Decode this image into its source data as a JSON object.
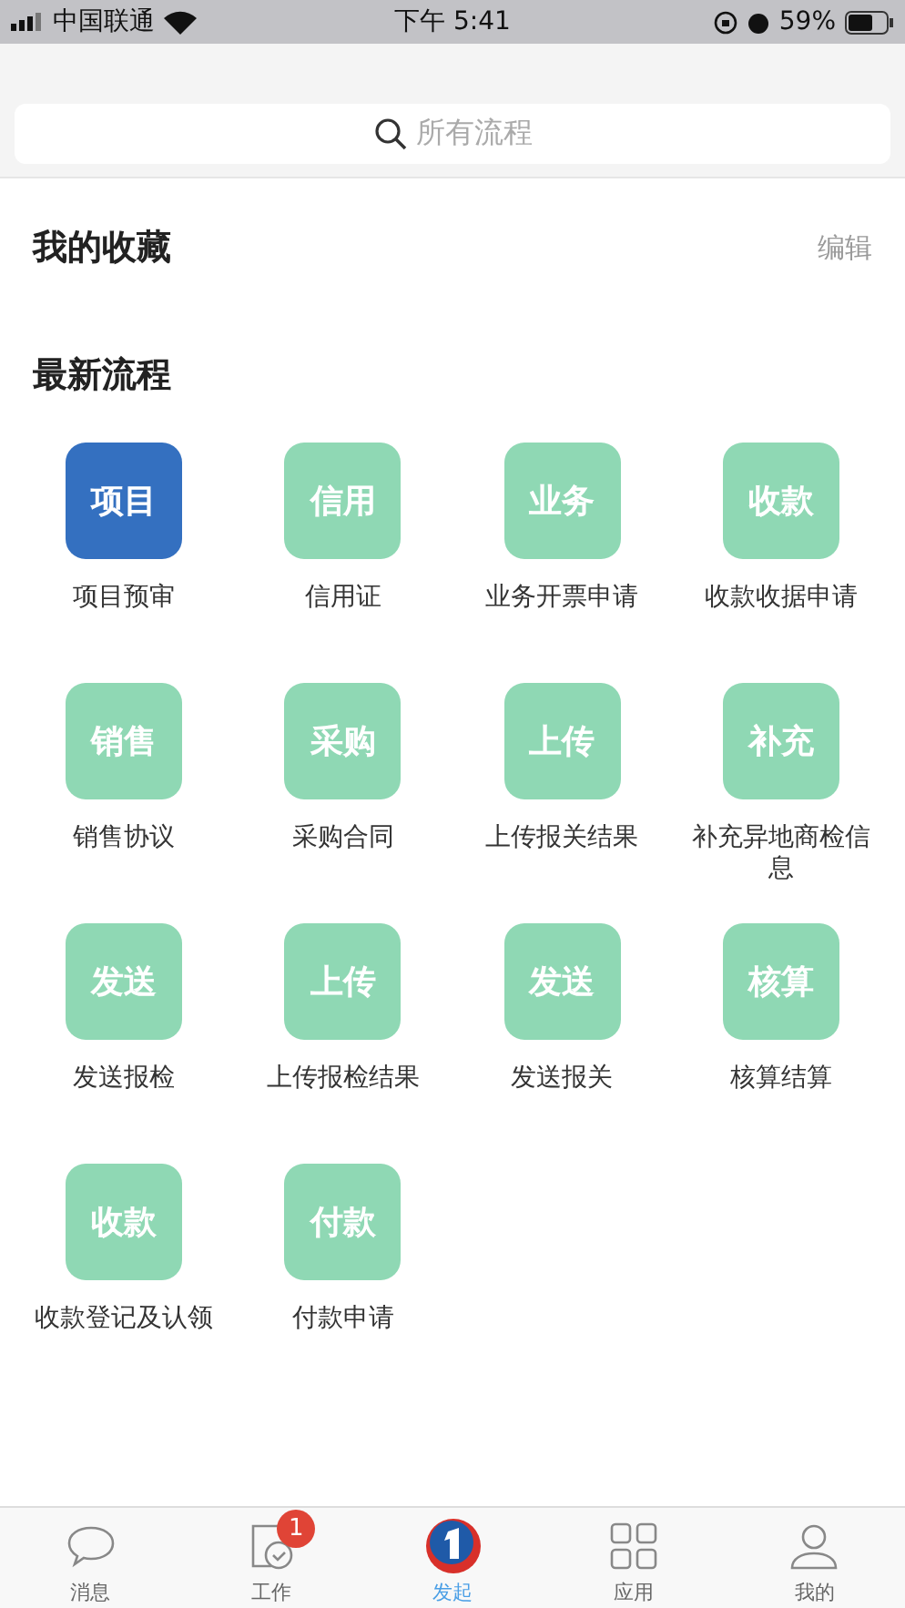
{
  "status_bar": {
    "carrier": "中国联通",
    "time": "下午 5:41",
    "battery": "59%"
  },
  "search": {
    "placeholder": "所有流程"
  },
  "favorites": {
    "title": "我的收藏",
    "action": "编辑"
  },
  "recent": {
    "title": "最新流程",
    "items": [
      {
        "icon_text": "项目",
        "label": "项目预审",
        "selected": true
      },
      {
        "icon_text": "信用",
        "label": "信用证",
        "selected": false
      },
      {
        "icon_text": "业务",
        "label": "业务开票申请",
        "selected": false
      },
      {
        "icon_text": "收款",
        "label": "收款收据申请",
        "selected": false
      },
      {
        "icon_text": "销售",
        "label": "销售协议",
        "selected": false
      },
      {
        "icon_text": "采购",
        "label": "采购合同",
        "selected": false
      },
      {
        "icon_text": "上传",
        "label": "上传报关结果",
        "selected": false
      },
      {
        "icon_text": "补充",
        "label": "补充异地商检信息",
        "selected": false
      },
      {
        "icon_text": "发送",
        "label": "发送报检",
        "selected": false
      },
      {
        "icon_text": "上传",
        "label": "上传报检结果",
        "selected": false
      },
      {
        "icon_text": "发送",
        "label": "发送报关",
        "selected": false
      },
      {
        "icon_text": "核算",
        "label": "核算结算",
        "selected": false
      },
      {
        "icon_text": "收款",
        "label": "收款登记及认领",
        "selected": false
      },
      {
        "icon_text": "付款",
        "label": "付款申请",
        "selected": false
      }
    ]
  },
  "tab_bar": [
    {
      "kind": "chat",
      "label": "消息",
      "selected": false
    },
    {
      "kind": "work",
      "label": "工作",
      "badge": "1",
      "selected": false
    },
    {
      "kind": "launch",
      "label": "发起",
      "selected": true
    },
    {
      "kind": "apps",
      "label": "应用",
      "selected": false
    },
    {
      "kind": "me",
      "label": "我的",
      "selected": false
    }
  ]
}
